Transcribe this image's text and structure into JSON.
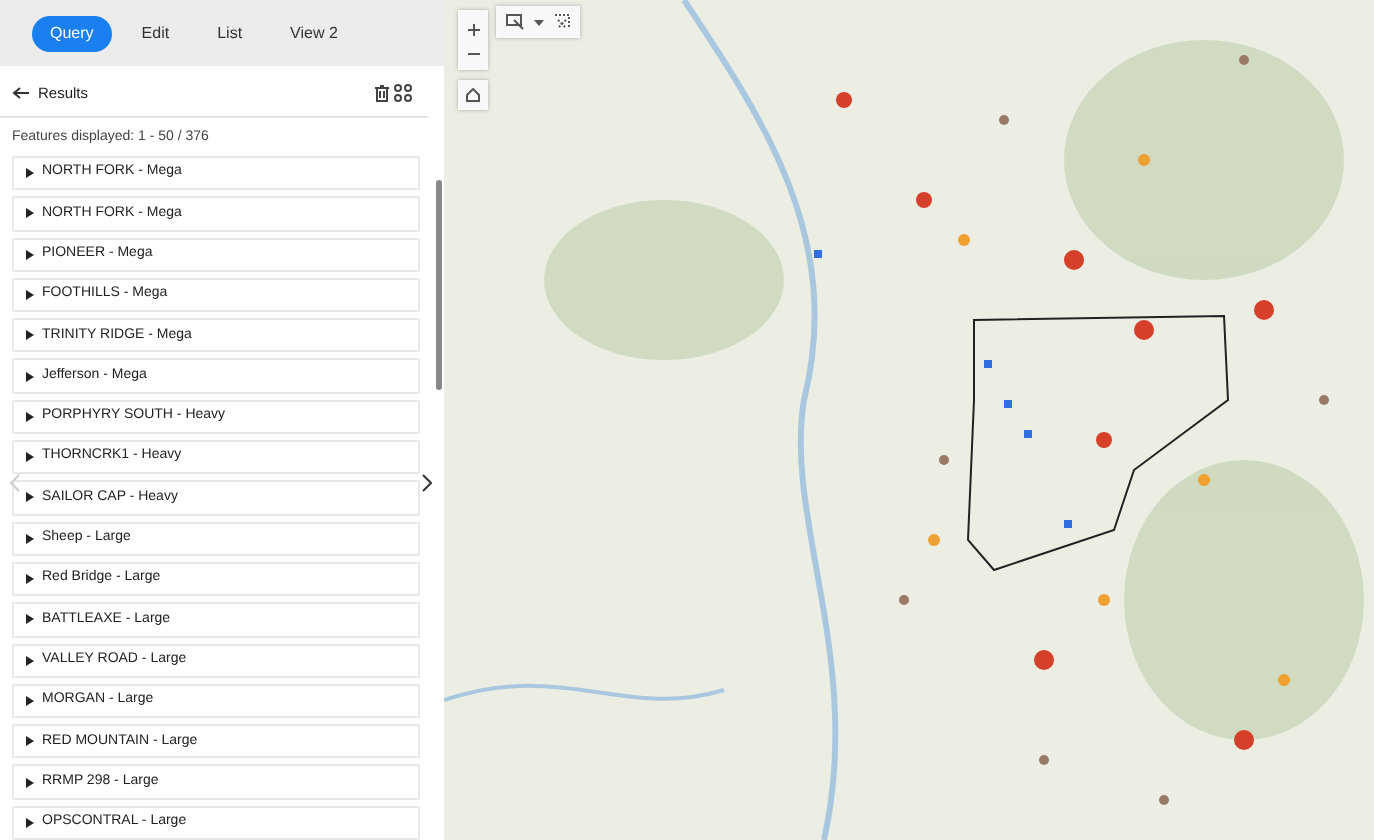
{
  "tabs": [
    {
      "label": "Query",
      "selected": true
    },
    {
      "label": "Edit",
      "selected": false
    },
    {
      "label": "List",
      "selected": false
    },
    {
      "label": "View 2",
      "selected": false
    }
  ],
  "results": {
    "title": "Results",
    "summary": "Features displayed: 1 - 50 / 376",
    "items": [
      {
        "label": "NORTH FORK - Mega",
        "expanded": false
      },
      {
        "label": "NORTH FORK - Mega",
        "expanded": false
      },
      {
        "label": "PIONEER - Mega",
        "expanded": false
      },
      {
        "label": "FOOTHILLS - Mega",
        "expanded": false
      },
      {
        "label": "TRINITY RIDGE - Mega",
        "expanded": false
      },
      {
        "label": "Jefferson - Mega",
        "expanded": false
      },
      {
        "label": "PORPHYRY SOUTH - Heavy",
        "expanded": false
      },
      {
        "label": "THORNCRK1 - Heavy",
        "expanded": false
      },
      {
        "label": "SAILOR CAP - Heavy",
        "expanded": false
      },
      {
        "label": "Sheep - Large",
        "expanded": false
      },
      {
        "label": "Red Bridge - Large",
        "expanded": false
      },
      {
        "label": "BATTLEAXE - Large",
        "expanded": false
      },
      {
        "label": "VALLEY ROAD - Large",
        "expanded": false
      },
      {
        "label": "MORGAN - Large",
        "expanded": false
      },
      {
        "label": "RED MOUNTAIN - Large",
        "expanded": false
      },
      {
        "label": "RRMP 298 - Large",
        "expanded": false
      },
      {
        "label": "OPSCONTRAL - Large",
        "expanded": false
      }
    ]
  }
}
